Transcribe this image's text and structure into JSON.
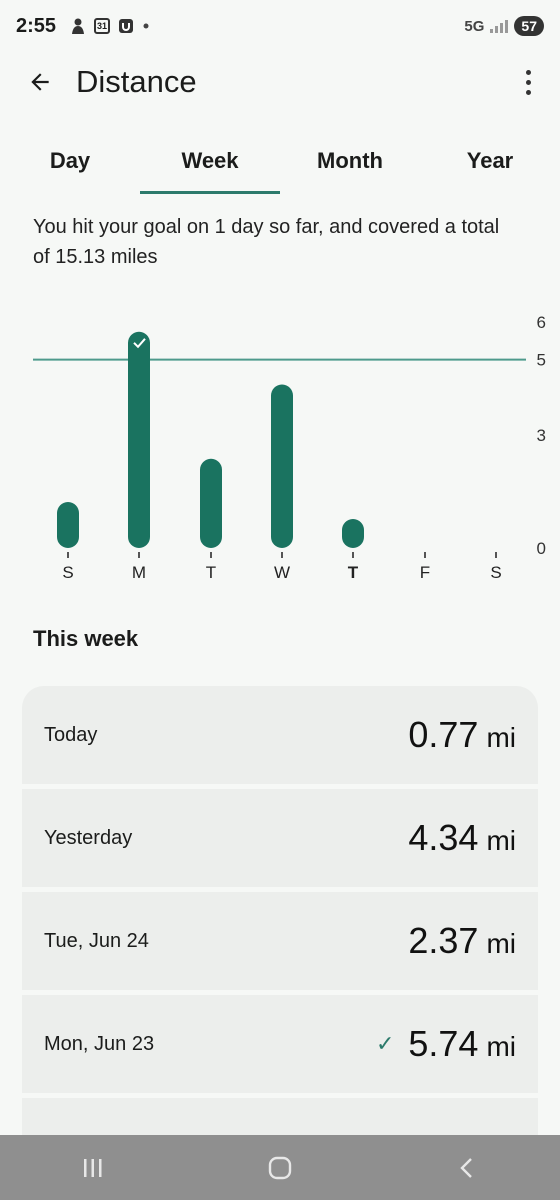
{
  "status": {
    "time": "2:55",
    "calendar_badge": "31",
    "network": "5G",
    "battery": "57"
  },
  "app_bar": {
    "title": "Distance"
  },
  "tabs": [
    {
      "label": "Day",
      "active": false
    },
    {
      "label": "Week",
      "active": true
    },
    {
      "label": "Month",
      "active": false
    },
    {
      "label": "Year",
      "active": false
    }
  ],
  "summary": "You hit your goal on 1 day so far, and covered a total of 15.13 miles",
  "colors": {
    "accent": "#1a7360",
    "goal_line": "#4e9a8c"
  },
  "chart_data": {
    "type": "bar",
    "categories": [
      "S",
      "M",
      "T",
      "W",
      "T",
      "F",
      "S"
    ],
    "values": [
      1.22,
      5.74,
      2.37,
      4.34,
      0.77,
      null,
      null
    ],
    "goal": 5,
    "y_ticks": [
      "6",
      "5",
      "3",
      "0"
    ],
    "ylim": [
      0,
      6
    ],
    "today_index": 4,
    "goal_met_indices": [
      1
    ]
  },
  "section_title": "This week",
  "days": [
    {
      "label": "Today",
      "value": "0.77",
      "unit": "mi",
      "goal_met": false
    },
    {
      "label": "Yesterday",
      "value": "4.34",
      "unit": "mi",
      "goal_met": false
    },
    {
      "label": "Tue, Jun 24",
      "value": "2.37",
      "unit": "mi",
      "goal_met": false
    },
    {
      "label": "Mon, Jun 23",
      "value": "5.74",
      "unit": "mi",
      "goal_met": true
    }
  ]
}
